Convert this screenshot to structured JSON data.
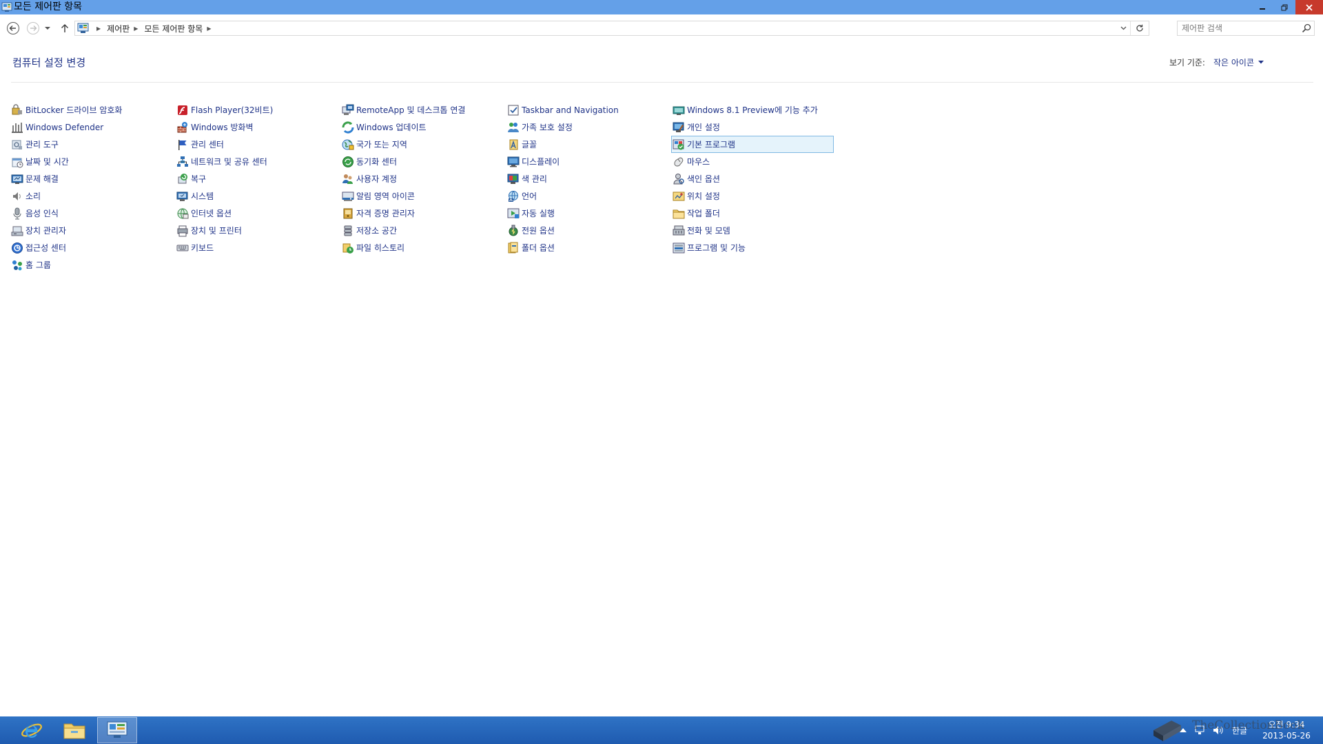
{
  "window": {
    "title": "모든 제어판 항목",
    "caption_color": "#64a0e8"
  },
  "address": {
    "breadcrumbs": [
      "제어판",
      "모든 제어판 항목"
    ]
  },
  "search": {
    "placeholder": "제어판 검색"
  },
  "header": {
    "title": "컴퓨터 설정 변경",
    "view_by_label": "보기 기준:",
    "view_by_value": "작은 아이콘"
  },
  "items": [
    {
      "label": "BitLocker 드라이브 암호화",
      "icon": "bitlocker-icon"
    },
    {
      "label": "Windows Defender",
      "icon": "windows-defender-icon"
    },
    {
      "label": "관리 도구",
      "icon": "admin-tools-icon"
    },
    {
      "label": "날짜 및 시간",
      "icon": "date-time-icon"
    },
    {
      "label": "문제 해결",
      "icon": "troubleshooting-icon"
    },
    {
      "label": "소리",
      "icon": "sound-icon"
    },
    {
      "label": "음성 인식",
      "icon": "speech-recognition-icon"
    },
    {
      "label": "장치 관리자",
      "icon": "device-manager-icon"
    },
    {
      "label": "접근성 센터",
      "icon": "ease-of-access-icon"
    },
    {
      "label": "홈 그룹",
      "icon": "homegroup-icon"
    },
    {
      "label": "Flash Player(32비트)",
      "icon": "flash-player-icon"
    },
    {
      "label": "Windows 방화벽",
      "icon": "firewall-icon"
    },
    {
      "label": "관리 센터",
      "icon": "action-center-icon"
    },
    {
      "label": "네트워크 및 공유 센터",
      "icon": "network-icon"
    },
    {
      "label": "복구",
      "icon": "recovery-icon"
    },
    {
      "label": "시스템",
      "icon": "system-icon"
    },
    {
      "label": "인터넷 옵션",
      "icon": "internet-options-icon"
    },
    {
      "label": "장치 및 프린터",
      "icon": "devices-printers-icon"
    },
    {
      "label": "키보드",
      "icon": "keyboard-icon"
    },
    {
      "label": "RemoteApp 및 데스크톱 연결",
      "icon": "remoteapp-icon"
    },
    {
      "label": "Windows 업데이트",
      "icon": "windows-update-icon"
    },
    {
      "label": "국가 또는 지역",
      "icon": "region-icon"
    },
    {
      "label": "동기화 센터",
      "icon": "sync-center-icon"
    },
    {
      "label": "사용자 계정",
      "icon": "user-accounts-icon"
    },
    {
      "label": "알림 영역 아이콘",
      "icon": "notification-area-icon"
    },
    {
      "label": "자격 증명 관리자",
      "icon": "credential-manager-icon"
    },
    {
      "label": "저장소 공간",
      "icon": "storage-spaces-icon"
    },
    {
      "label": "파일 히스토리",
      "icon": "file-history-icon"
    },
    {
      "label": "Taskbar and Navigation",
      "icon": "taskbar-icon"
    },
    {
      "label": "가족 보호 설정",
      "icon": "family-safety-icon"
    },
    {
      "label": "글꼴",
      "icon": "fonts-icon"
    },
    {
      "label": "디스플레이",
      "icon": "display-icon"
    },
    {
      "label": "색 관리",
      "icon": "color-management-icon"
    },
    {
      "label": "언어",
      "icon": "language-icon"
    },
    {
      "label": "자동 실행",
      "icon": "autoplay-icon"
    },
    {
      "label": "전원 옵션",
      "icon": "power-options-icon"
    },
    {
      "label": "폴더 옵션",
      "icon": "folder-options-icon"
    },
    {
      "label": "Windows 8.1 Preview에 기능 추가",
      "icon": "add-features-icon"
    },
    {
      "label": "개인 설정",
      "icon": "personalization-icon"
    },
    {
      "label": "기본 프로그램",
      "icon": "default-programs-icon",
      "selected": true
    },
    {
      "label": "마우스",
      "icon": "mouse-icon"
    },
    {
      "label": "색인 옵션",
      "icon": "indexing-options-icon"
    },
    {
      "label": "위치 설정",
      "icon": "location-settings-icon"
    },
    {
      "label": "작업 폴더",
      "icon": "work-folders-icon"
    },
    {
      "label": "전화 및 모뎀",
      "icon": "phone-modem-icon"
    },
    {
      "label": "프로그램 및 기능",
      "icon": "programs-features-icon"
    }
  ],
  "taskbar": {
    "ime_label": "한글",
    "time": "오전 9:34",
    "date": "2013-05-26"
  },
  "watermark": "TheCollectionBook"
}
